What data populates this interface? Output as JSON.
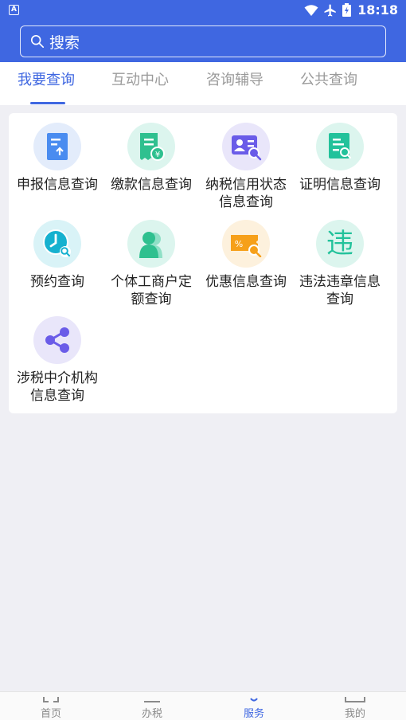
{
  "status_bar": {
    "app_badge": "A",
    "time": "18:18",
    "icons": [
      "wifi-icon",
      "airplane-icon",
      "battery-icon"
    ]
  },
  "search": {
    "placeholder": "搜索"
  },
  "tabs": [
    {
      "label": "我要查询",
      "active": true
    },
    {
      "label": "互动中心",
      "active": false
    },
    {
      "label": "咨询辅导",
      "active": false
    },
    {
      "label": "公共查询",
      "active": false
    }
  ],
  "grid": [
    {
      "label": "申报信息查询",
      "icon": "document-upload-icon"
    },
    {
      "label": "缴款信息查询",
      "icon": "receipt-yuan-icon"
    },
    {
      "label": "纳税信用状态信息查询",
      "icon": "id-card-search-icon"
    },
    {
      "label": "证明信息查询",
      "icon": "document-search-icon"
    },
    {
      "label": "预约查询",
      "icon": "clock-search-icon"
    },
    {
      "label": "个体工商户定额查询",
      "icon": "person-icon"
    },
    {
      "label": "优惠信息查询",
      "icon": "coupon-percent-icon"
    },
    {
      "label": "违法违章信息查询",
      "icon": "violation-icon",
      "glyph": "违"
    },
    {
      "label": "涉税中介机构信息查询",
      "icon": "share-icon"
    }
  ],
  "bottom_nav": [
    {
      "label": "首页",
      "active": false
    },
    {
      "label": "办税",
      "active": false
    },
    {
      "label": "服务",
      "active": true
    },
    {
      "label": "我的",
      "active": false
    }
  ],
  "colors": {
    "primary": "#3f67e1",
    "background": "#efeff4"
  }
}
